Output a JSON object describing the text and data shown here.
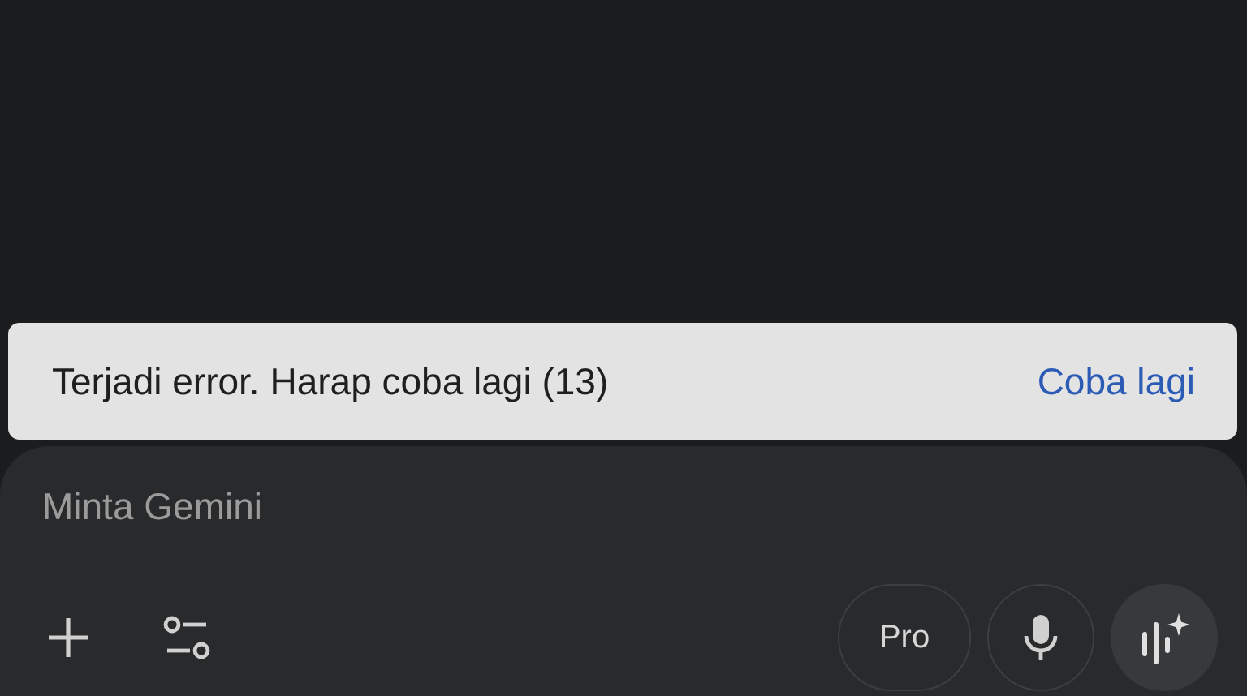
{
  "snackbar": {
    "message": "Terjadi error. Harap coba lagi (13)",
    "action": "Coba lagi"
  },
  "prompt": {
    "placeholder": "Minta Gemini"
  },
  "toolbar": {
    "model_label": "Pro"
  }
}
